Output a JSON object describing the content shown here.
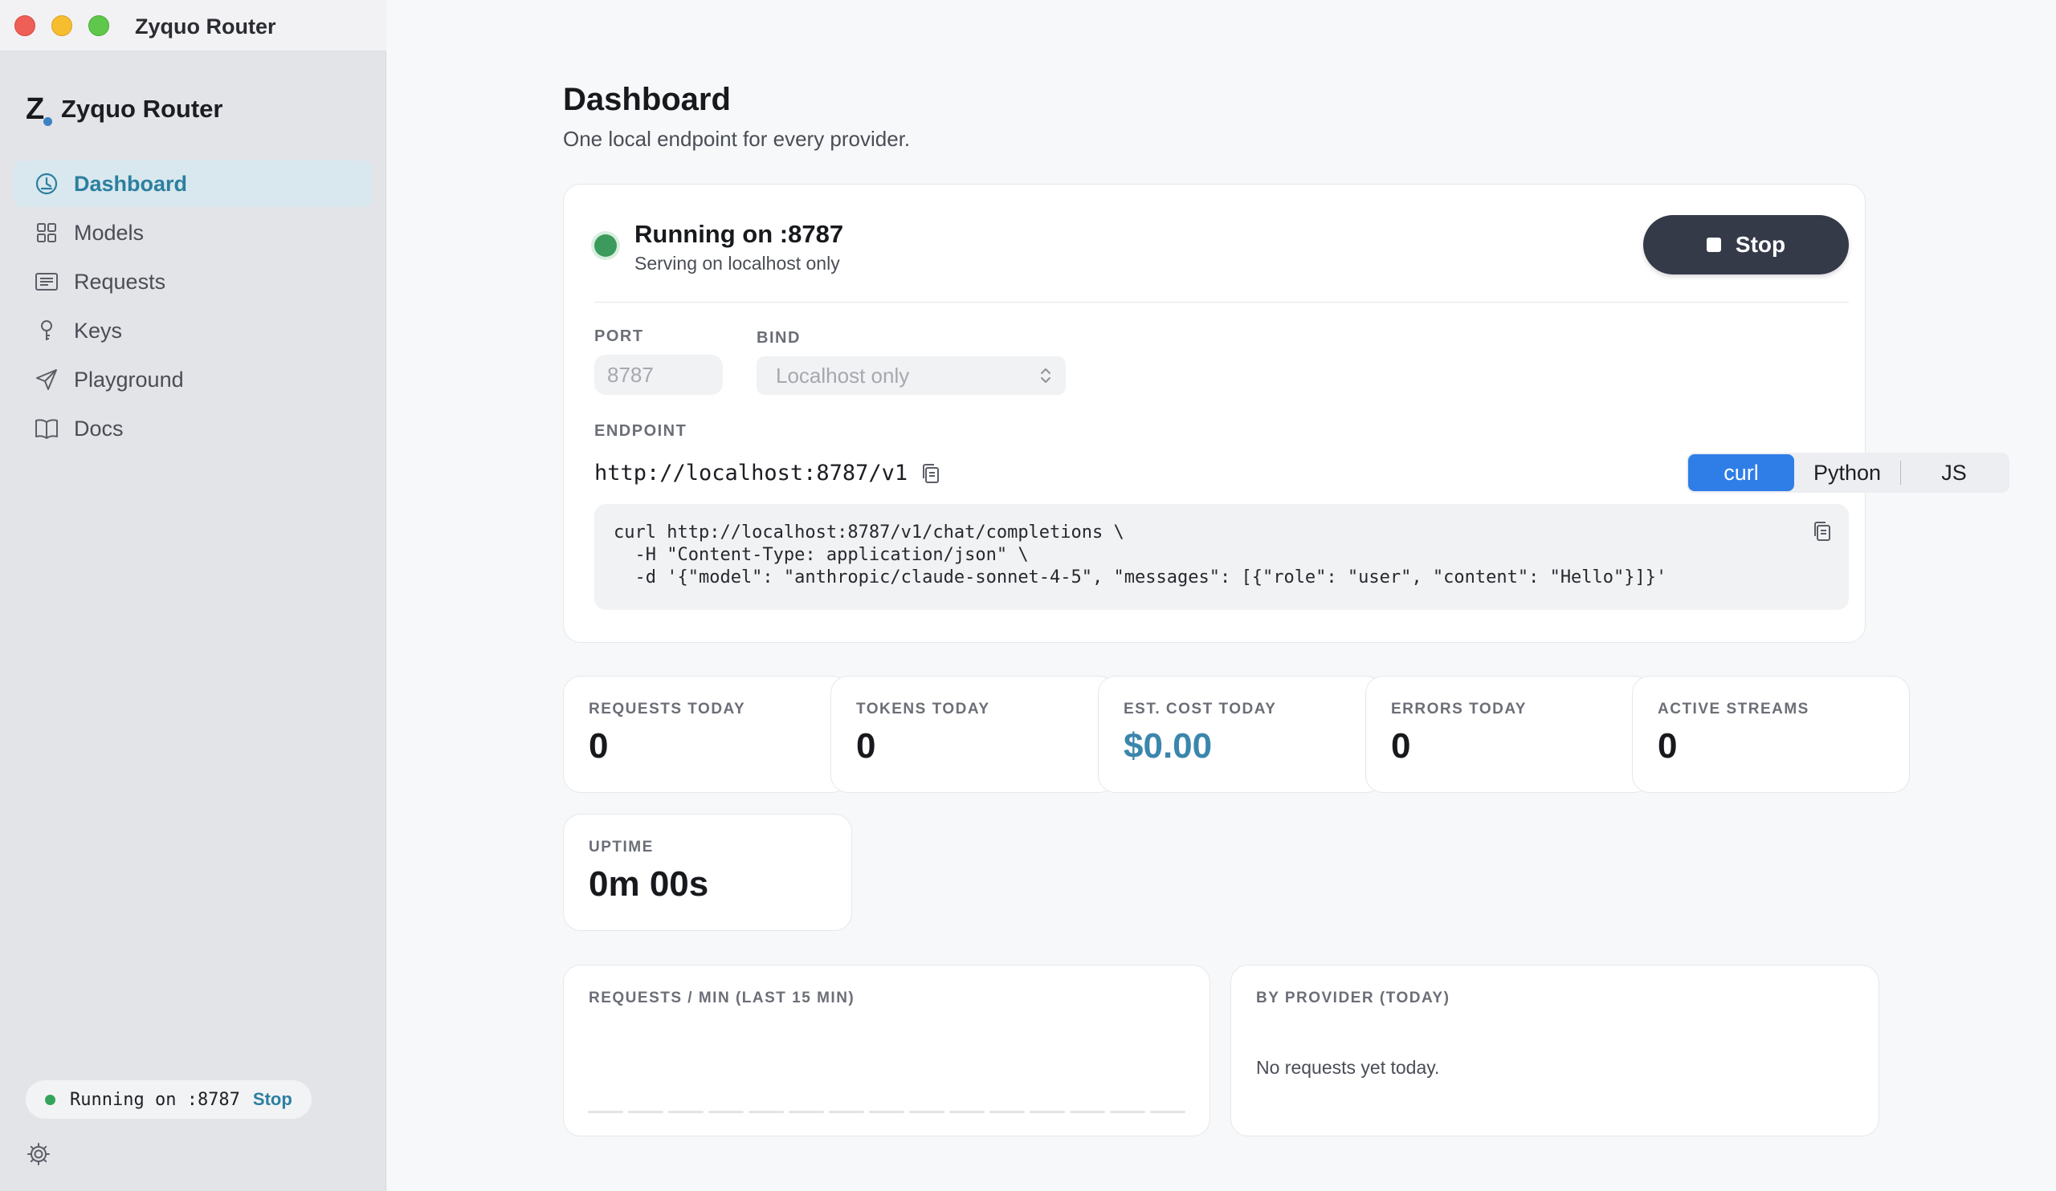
{
  "window": {
    "title": "Zyquo Router"
  },
  "brand": {
    "logo_letter": "Z",
    "name": "Zyquo Router",
    "accent": "#3b82c4"
  },
  "sidebar": {
    "items": [
      {
        "label": "Dashboard",
        "icon": "dashboard-icon",
        "active": true
      },
      {
        "label": "Models",
        "icon": "grid-icon",
        "active": false
      },
      {
        "label": "Requests",
        "icon": "list-icon",
        "active": false
      },
      {
        "label": "Keys",
        "icon": "key-icon",
        "active": false
      },
      {
        "label": "Playground",
        "icon": "send-icon",
        "active": false
      },
      {
        "label": "Docs",
        "icon": "book-icon",
        "active": false
      }
    ],
    "status": {
      "text": "Running on :8787",
      "stop_label": "Stop",
      "color": "#34a45a"
    },
    "settings_icon": "gear-icon"
  },
  "page": {
    "title": "Dashboard",
    "subtitle": "One local endpoint for every provider."
  },
  "server": {
    "status_title": "Running on :8787",
    "status_sub": "Serving on localhost only",
    "stop_label": "Stop",
    "port_label": "PORT",
    "port_value": "8787",
    "bind_label": "BIND",
    "bind_value": "Localhost only",
    "endpoint_label": "ENDPOINT",
    "endpoint_url": "http://localhost:8787/v1",
    "tabs": [
      "curl",
      "Python",
      "JS"
    ],
    "active_tab": "curl",
    "code_lines": [
      "curl http://localhost:8787/v1/chat/completions \\",
      "  -H \"Content-Type: application/json\" \\",
      "  -d '{\"model\": \"anthropic/claude-sonnet-4-5\", \"messages\": [{\"role\": \"user\", \"content\": \"Hello\"}]}'"
    ]
  },
  "stats": [
    {
      "label": "REQUESTS TODAY",
      "value": "0"
    },
    {
      "label": "TOKENS TODAY",
      "value": "0"
    },
    {
      "label": "EST. COST TODAY",
      "value": "$0.00",
      "accent": "#3b86ac"
    },
    {
      "label": "ERRORS TODAY",
      "value": "0"
    },
    {
      "label": "ACTIVE STREAMS",
      "value": "0"
    }
  ],
  "uptime": {
    "label": "UPTIME",
    "value": "0m 00s"
  },
  "requests_chart": {
    "label": "REQUESTS / MIN (LAST 15 MIN)",
    "values": [
      0,
      0,
      0,
      0,
      0,
      0,
      0,
      0,
      0,
      0,
      0,
      0,
      0,
      0,
      0
    ]
  },
  "provider": {
    "label": "BY PROVIDER (TODAY)",
    "empty": "No requests yet today."
  }
}
